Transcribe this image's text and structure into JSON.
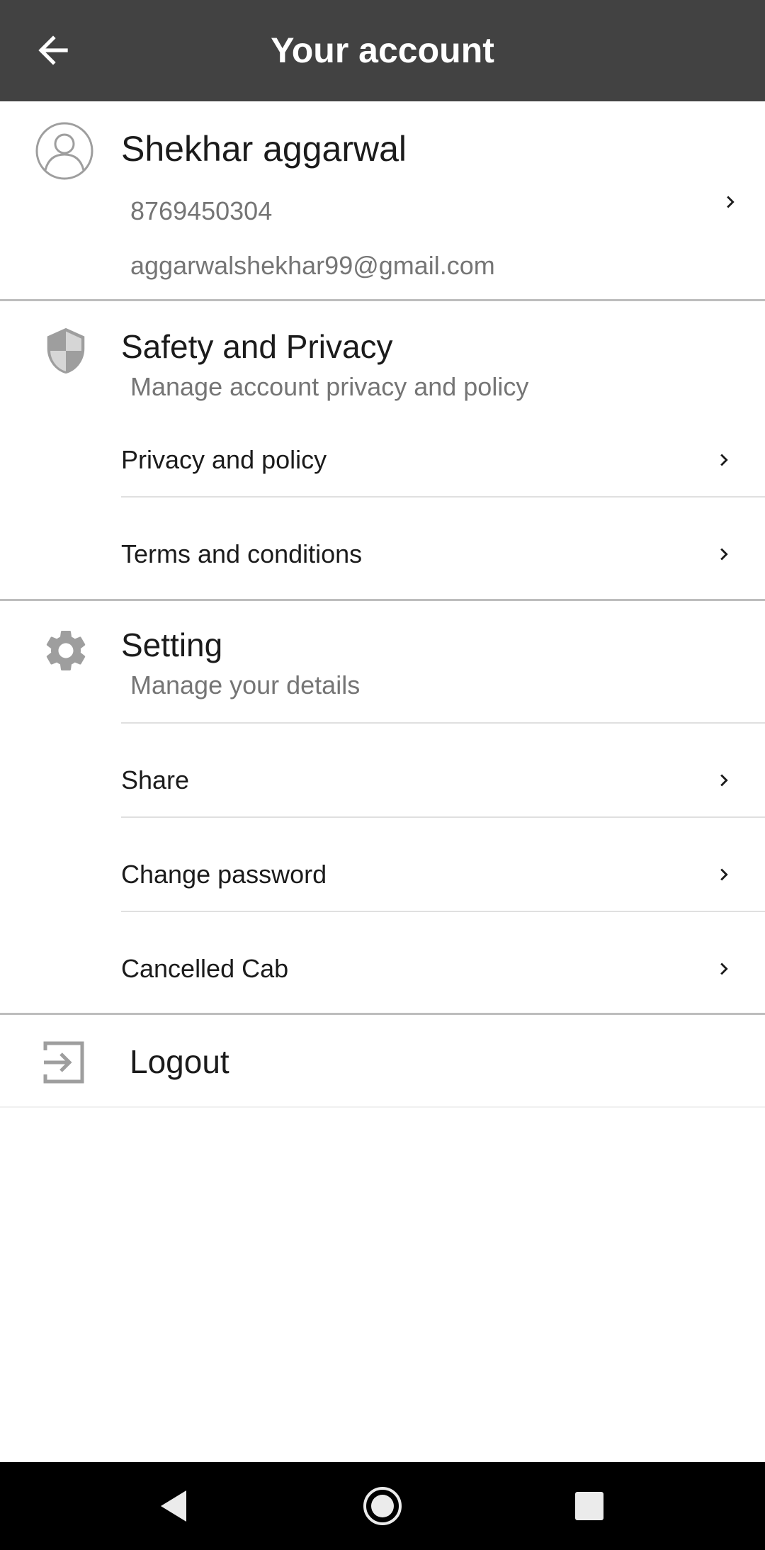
{
  "header": {
    "title": "Your account",
    "back_icon": "arrow-left-icon"
  },
  "profile": {
    "name": "Shekhar aggarwal",
    "phone": "8769450304",
    "email": "aggarwalshekhar99@gmail.com",
    "avatar_icon": "user-avatar-icon"
  },
  "safety": {
    "title": "Safety and Privacy",
    "subtitle": "Manage account privacy and policy",
    "icon": "shield-icon",
    "items": [
      {
        "label": "Privacy and policy"
      },
      {
        "label": "Terms and conditions"
      }
    ]
  },
  "settings": {
    "title": "Setting",
    "subtitle": "Manage your details",
    "icon": "gear-icon",
    "items": [
      {
        "label": "Share"
      },
      {
        "label": "Change password"
      },
      {
        "label": "Cancelled Cab"
      }
    ]
  },
  "logout": {
    "label": "Logout",
    "icon": "logout-icon"
  },
  "navbar": {
    "buttons": [
      "back-triangle-icon",
      "home-circle-icon",
      "recents-square-icon"
    ]
  },
  "colors": {
    "topbar": "#424242",
    "icon_gray": "#9e9e9e",
    "text_primary": "#1b1b1b",
    "text_secondary": "#757575"
  }
}
